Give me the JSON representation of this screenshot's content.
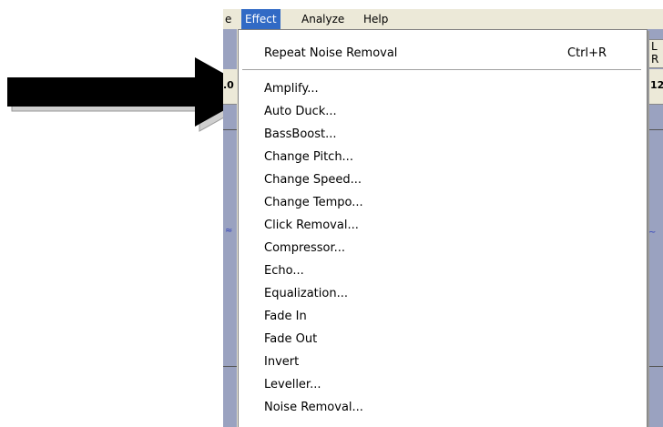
{
  "menubar": {
    "partial_item": "e",
    "effect": "Effect",
    "analyze": "Analyze",
    "help": "Help"
  },
  "side": {
    "left_ruler": ".0",
    "right_ruler": "12",
    "lr_l": "L",
    "lr_r": "R"
  },
  "menu": {
    "items": [
      {
        "label": "Repeat Noise Removal",
        "shortcut": "Ctrl+R"
      },
      {
        "label": "Amplify..."
      },
      {
        "label": "Auto Duck..."
      },
      {
        "label": "BassBoost..."
      },
      {
        "label": "Change Pitch..."
      },
      {
        "label": "Change Speed..."
      },
      {
        "label": "Change Tempo..."
      },
      {
        "label": "Click Removal..."
      },
      {
        "label": "Compressor..."
      },
      {
        "label": "Echo..."
      },
      {
        "label": "Equalization..."
      },
      {
        "label": "Fade In"
      },
      {
        "label": "Fade Out"
      },
      {
        "label": "Invert"
      },
      {
        "label": "Leveller..."
      },
      {
        "label": "Noise Removal..."
      }
    ]
  },
  "colors": {
    "menu_highlight": "#316ac5",
    "arrow": "#000000"
  }
}
